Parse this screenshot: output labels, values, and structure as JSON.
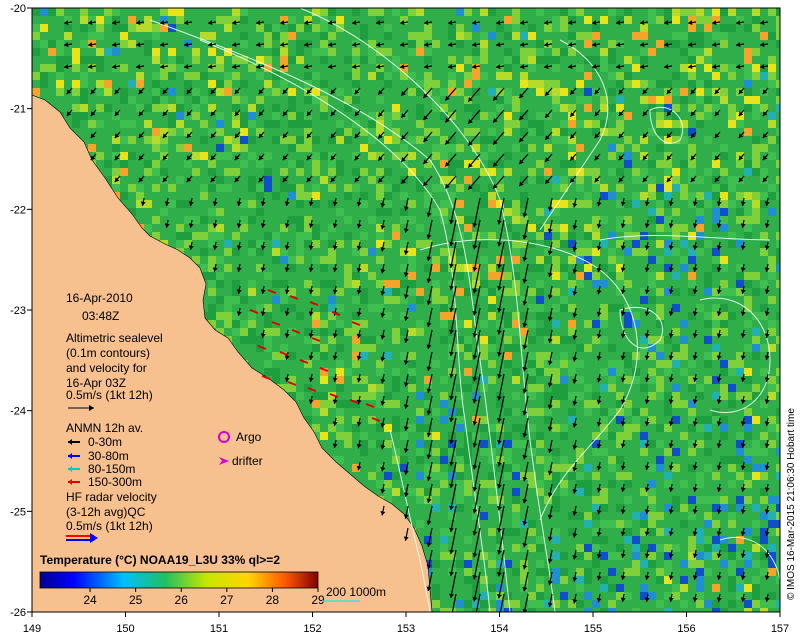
{
  "map": {
    "colors": {
      "land": "#f7c08f",
      "ocean_base": "#2fae4a",
      "contour": "#e8fff4",
      "arrow": "#000000",
      "anmn_0_30": "#000000",
      "anmn_30_80": "#0000ff",
      "anmn_80_150": "#00c8c8",
      "anmn_150_300": "#e00000",
      "argo": "#d400d4",
      "drifter": "#d400d4",
      "depth_line": "#40e0d0"
    },
    "lon_ticks": [
      "149",
      "150",
      "151",
      "152",
      "153",
      "154",
      "155",
      "156",
      "157"
    ],
    "lat_ticks": [
      "-20",
      "-21",
      "-22",
      "-23",
      "-24",
      "-25",
      "-26"
    ]
  },
  "legend": {
    "date": "16-Apr-2010",
    "time": "03:48Z",
    "altimetry_lines": [
      "Altimetric sealevel",
      "(0.1m contours)",
      "and velocity for",
      "16-Apr 03Z"
    ],
    "scale_label": "0.5m/s (1kt 12h)",
    "anmn_title": "ANMN 12h av.",
    "anmn_items": [
      "0-30m",
      "30-80m",
      "80-150m",
      "150-300m"
    ],
    "argo_label": "Argo",
    "drifter_label": "drifter",
    "hf_lines": [
      "HF radar velocity",
      "(3-12h avg)QC",
      "0.5m/s (1kt 12h)"
    ]
  },
  "colorbar": {
    "title": "Temperature (°C) NOAA19_L3U 33% ql>=2",
    "ticks": [
      "24",
      "25",
      "26",
      "27",
      "28",
      "29"
    ],
    "depth_label": "200  1000m"
  },
  "credit": "© IMOS 16-Mar-2015 21:06:30 Hobart time"
}
